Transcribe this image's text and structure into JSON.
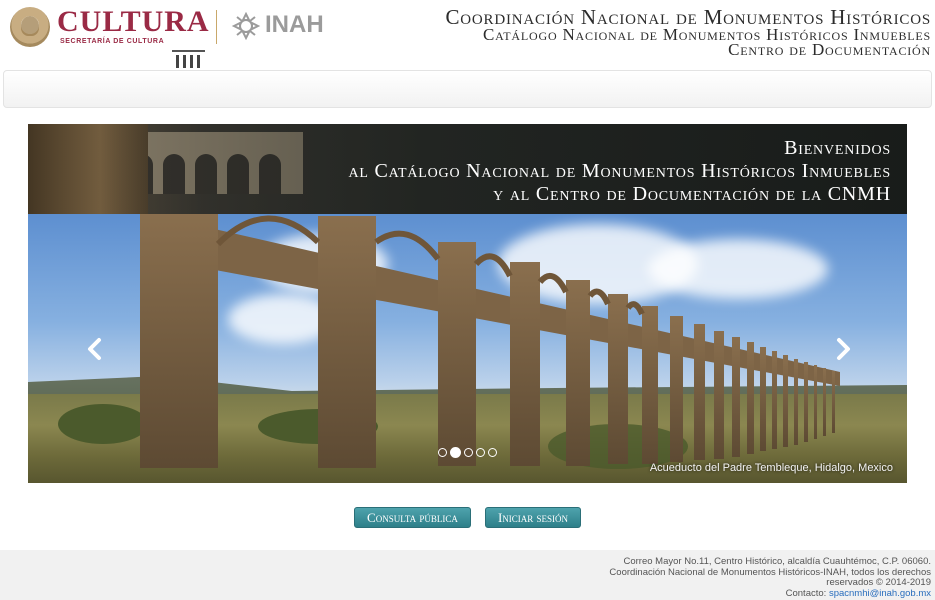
{
  "header": {
    "cultura_logo_text": "CULTURA",
    "cultura_logo_subtext": "SECRETARÍA DE CULTURA",
    "inah_logo_text": "INAH",
    "title_line1": "Coordinación Nacional de Monumentos Históricos",
    "title_line2": "Catálogo Nacional de Monumentos Históricos Inmuebles",
    "title_line3": "Centro de Documentación"
  },
  "carousel": {
    "welcome_line1": "Bienvenidos",
    "welcome_line2": "al Catálogo Nacional de Monumentos Históricos Inmuebles",
    "welcome_line3": "y al Centro de Documentación de la CNMH",
    "caption": "Acueducto del Padre Tembleque, Hidalgo, Mexico",
    "prev_icon": "chevron-left-icon",
    "next_icon": "chevron-right-icon",
    "slide_count": 5,
    "active_slide": 2
  },
  "buttons": {
    "consulta_label": "Consulta pública",
    "login_label": "Iniciar sesión",
    "color": "#3a8f99"
  },
  "footer": {
    "line1": "Correo Mayor No.11, Centro Histórico, alcaldía Cuauhtémoc, C.P. 06060.",
    "line2": "Coordinación Nacional de Monumentos Históricos-INAH, todos los derechos",
    "line3": "reservados © 2014-2019",
    "contact_label": "Contacto:",
    "contact_email": "spacnmhi@inah.gob.mx"
  },
  "colors": {
    "cultura": "#9a2a45",
    "inah": "#9b9b9b",
    "link": "#2a6ebd"
  }
}
